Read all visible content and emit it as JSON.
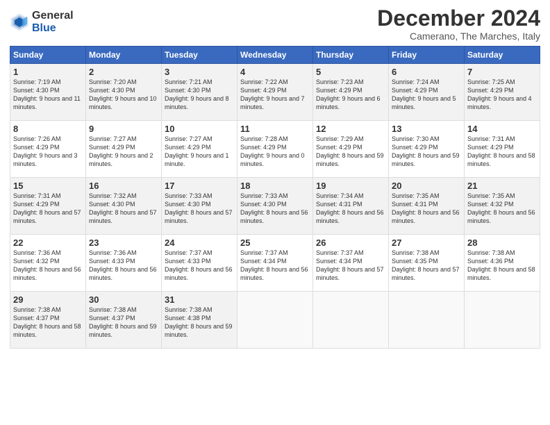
{
  "logo": {
    "line1": "General",
    "line2": "Blue"
  },
  "title": "December 2024",
  "subtitle": "Camerano, The Marches, Italy",
  "weekdays": [
    "Sunday",
    "Monday",
    "Tuesday",
    "Wednesday",
    "Thursday",
    "Friday",
    "Saturday"
  ],
  "weeks": [
    [
      {
        "day": "1",
        "sunrise": "Sunrise: 7:19 AM",
        "sunset": "Sunset: 4:30 PM",
        "daylight": "Daylight: 9 hours and 11 minutes."
      },
      {
        "day": "2",
        "sunrise": "Sunrise: 7:20 AM",
        "sunset": "Sunset: 4:30 PM",
        "daylight": "Daylight: 9 hours and 10 minutes."
      },
      {
        "day": "3",
        "sunrise": "Sunrise: 7:21 AM",
        "sunset": "Sunset: 4:30 PM",
        "daylight": "Daylight: 9 hours and 8 minutes."
      },
      {
        "day": "4",
        "sunrise": "Sunrise: 7:22 AM",
        "sunset": "Sunset: 4:29 PM",
        "daylight": "Daylight: 9 hours and 7 minutes."
      },
      {
        "day": "5",
        "sunrise": "Sunrise: 7:23 AM",
        "sunset": "Sunset: 4:29 PM",
        "daylight": "Daylight: 9 hours and 6 minutes."
      },
      {
        "day": "6",
        "sunrise": "Sunrise: 7:24 AM",
        "sunset": "Sunset: 4:29 PM",
        "daylight": "Daylight: 9 hours and 5 minutes."
      },
      {
        "day": "7",
        "sunrise": "Sunrise: 7:25 AM",
        "sunset": "Sunset: 4:29 PM",
        "daylight": "Daylight: 9 hours and 4 minutes."
      }
    ],
    [
      {
        "day": "8",
        "sunrise": "Sunrise: 7:26 AM",
        "sunset": "Sunset: 4:29 PM",
        "daylight": "Daylight: 9 hours and 3 minutes."
      },
      {
        "day": "9",
        "sunrise": "Sunrise: 7:27 AM",
        "sunset": "Sunset: 4:29 PM",
        "daylight": "Daylight: 9 hours and 2 minutes."
      },
      {
        "day": "10",
        "sunrise": "Sunrise: 7:27 AM",
        "sunset": "Sunset: 4:29 PM",
        "daylight": "Daylight: 9 hours and 1 minute."
      },
      {
        "day": "11",
        "sunrise": "Sunrise: 7:28 AM",
        "sunset": "Sunset: 4:29 PM",
        "daylight": "Daylight: 9 hours and 0 minutes."
      },
      {
        "day": "12",
        "sunrise": "Sunrise: 7:29 AM",
        "sunset": "Sunset: 4:29 PM",
        "daylight": "Daylight: 8 hours and 59 minutes."
      },
      {
        "day": "13",
        "sunrise": "Sunrise: 7:30 AM",
        "sunset": "Sunset: 4:29 PM",
        "daylight": "Daylight: 8 hours and 59 minutes."
      },
      {
        "day": "14",
        "sunrise": "Sunrise: 7:31 AM",
        "sunset": "Sunset: 4:29 PM",
        "daylight": "Daylight: 8 hours and 58 minutes."
      }
    ],
    [
      {
        "day": "15",
        "sunrise": "Sunrise: 7:31 AM",
        "sunset": "Sunset: 4:29 PM",
        "daylight": "Daylight: 8 hours and 57 minutes."
      },
      {
        "day": "16",
        "sunrise": "Sunrise: 7:32 AM",
        "sunset": "Sunset: 4:30 PM",
        "daylight": "Daylight: 8 hours and 57 minutes."
      },
      {
        "day": "17",
        "sunrise": "Sunrise: 7:33 AM",
        "sunset": "Sunset: 4:30 PM",
        "daylight": "Daylight: 8 hours and 57 minutes."
      },
      {
        "day": "18",
        "sunrise": "Sunrise: 7:33 AM",
        "sunset": "Sunset: 4:30 PM",
        "daylight": "Daylight: 8 hours and 56 minutes."
      },
      {
        "day": "19",
        "sunrise": "Sunrise: 7:34 AM",
        "sunset": "Sunset: 4:31 PM",
        "daylight": "Daylight: 8 hours and 56 minutes."
      },
      {
        "day": "20",
        "sunrise": "Sunrise: 7:35 AM",
        "sunset": "Sunset: 4:31 PM",
        "daylight": "Daylight: 8 hours and 56 minutes."
      },
      {
        "day": "21",
        "sunrise": "Sunrise: 7:35 AM",
        "sunset": "Sunset: 4:32 PM",
        "daylight": "Daylight: 8 hours and 56 minutes."
      }
    ],
    [
      {
        "day": "22",
        "sunrise": "Sunrise: 7:36 AM",
        "sunset": "Sunset: 4:32 PM",
        "daylight": "Daylight: 8 hours and 56 minutes."
      },
      {
        "day": "23",
        "sunrise": "Sunrise: 7:36 AM",
        "sunset": "Sunset: 4:33 PM",
        "daylight": "Daylight: 8 hours and 56 minutes."
      },
      {
        "day": "24",
        "sunrise": "Sunrise: 7:37 AM",
        "sunset": "Sunset: 4:33 PM",
        "daylight": "Daylight: 8 hours and 56 minutes."
      },
      {
        "day": "25",
        "sunrise": "Sunrise: 7:37 AM",
        "sunset": "Sunset: 4:34 PM",
        "daylight": "Daylight: 8 hours and 56 minutes."
      },
      {
        "day": "26",
        "sunrise": "Sunrise: 7:37 AM",
        "sunset": "Sunset: 4:34 PM",
        "daylight": "Daylight: 8 hours and 57 minutes."
      },
      {
        "day": "27",
        "sunrise": "Sunrise: 7:38 AM",
        "sunset": "Sunset: 4:35 PM",
        "daylight": "Daylight: 8 hours and 57 minutes."
      },
      {
        "day": "28",
        "sunrise": "Sunrise: 7:38 AM",
        "sunset": "Sunset: 4:36 PM",
        "daylight": "Daylight: 8 hours and 58 minutes."
      }
    ],
    [
      {
        "day": "29",
        "sunrise": "Sunrise: 7:38 AM",
        "sunset": "Sunset: 4:37 PM",
        "daylight": "Daylight: 8 hours and 58 minutes."
      },
      {
        "day": "30",
        "sunrise": "Sunrise: 7:38 AM",
        "sunset": "Sunset: 4:37 PM",
        "daylight": "Daylight: 8 hours and 59 minutes."
      },
      {
        "day": "31",
        "sunrise": "Sunrise: 7:38 AM",
        "sunset": "Sunset: 4:38 PM",
        "daylight": "Daylight: 8 hours and 59 minutes."
      },
      null,
      null,
      null,
      null
    ]
  ]
}
